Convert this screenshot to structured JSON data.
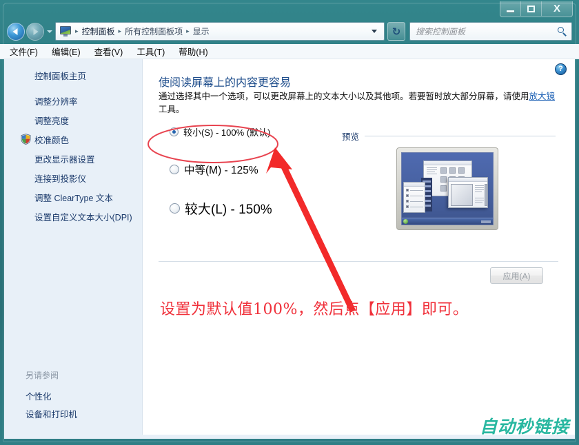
{
  "window": {
    "title": "显示",
    "controls": {
      "minimize": "最小化",
      "maximize": "最大化",
      "close": "关闭"
    }
  },
  "nav": {
    "back_tooltip": "后退",
    "forward_tooltip": "前进",
    "recent_tooltip": "最近的页面",
    "refresh_tooltip": "刷新",
    "breadcrumb": [
      "控制面板",
      "所有控制面板项",
      "显示"
    ],
    "separator": "▸",
    "icon": "control-panel-icon"
  },
  "search": {
    "placeholder": "搜索控制面板",
    "value": "",
    "icon": "search-icon"
  },
  "menubar": {
    "items": [
      "文件(F)",
      "编辑(E)",
      "查看(V)",
      "工具(T)",
      "帮助(H)"
    ]
  },
  "sidebar": {
    "home": "控制面板主页",
    "items": [
      {
        "label": "调整分辨率",
        "shield": false
      },
      {
        "label": "调整亮度",
        "shield": false
      },
      {
        "label": "校准颜色",
        "shield": true
      },
      {
        "label": "更改显示器设置",
        "shield": false
      },
      {
        "label": "连接到投影仪",
        "shield": false
      },
      {
        "label": "调整 ClearType 文本",
        "shield": false
      },
      {
        "label": "设置自定义文本大小(DPI)",
        "shield": false
      }
    ],
    "see_also_title": "另请参阅",
    "see_also": [
      "个性化",
      "设备和打印机"
    ]
  },
  "content": {
    "help_label": "?",
    "title": "使阅读屏幕上的内容更容易",
    "desc_before": "通过选择其中一个选项，可以更改屏幕上的文本大小以及其他项。若要暂时放大部分屏幕，请使用",
    "desc_link": "放大镜",
    "desc_after": "工具。",
    "options": [
      {
        "label": "较小(S) - 100% (默认)",
        "checked": true
      },
      {
        "label": "中等(M) - 125%",
        "checked": false
      },
      {
        "label": "较大(L) - 150%",
        "checked": false
      }
    ],
    "preview_title": "预览",
    "apply_label": "应用(A)",
    "apply_disabled": true
  },
  "annotation": {
    "text": "设置为默认值100%，然后点【应用】即可。",
    "color": "#f0303a",
    "ellipse_target": "较小(S) - 100% (默认)"
  },
  "watermark": {
    "text": "自动秒链接",
    "color": "#27b7a0"
  },
  "colors": {
    "frame": "#2c787f",
    "sidebar_bg": "#e8f0f8",
    "content_bg": "#ffffff",
    "link": "#1a5fb4",
    "title_blue": "#1f4e8c",
    "annotation_red": "#f0303a",
    "watermark_teal": "#27b7a0"
  }
}
